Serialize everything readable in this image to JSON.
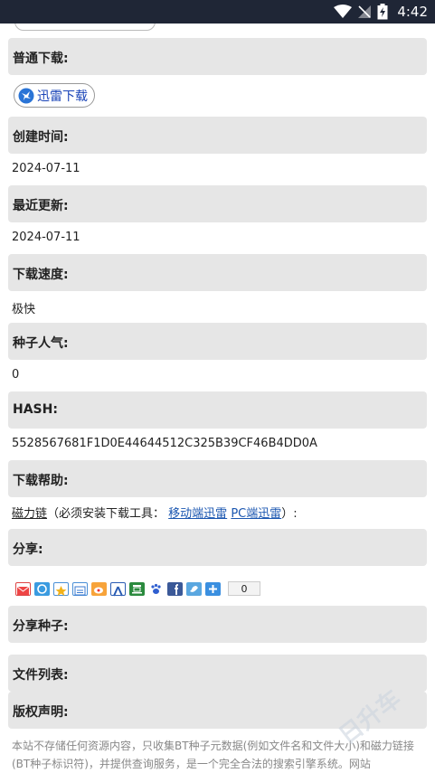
{
  "status": {
    "time": "4:42"
  },
  "sections": {
    "normal_download": "普通下载:",
    "created": "创建时间:",
    "updated": "最近更新:",
    "speed": "下载速度:",
    "popularity": "种子人气:",
    "hash": "HASH:",
    "help": "下载帮助:",
    "share": "分享:",
    "share_torrent": "分享种子:",
    "file_list": "文件列表:",
    "copyright": "版权声明:"
  },
  "values": {
    "created": "2024-07-11",
    "updated": "2024-07-11",
    "speed": "极快",
    "popularity": "0",
    "hash": "5528567681F1D0E44644512C325B39CF46B4DD0A"
  },
  "thunder_button": {
    "label": "迅雷下载"
  },
  "help_line": {
    "magnet": "磁力链",
    "text": "（必须安装下载工具：",
    "mobile_link": "移动端迅雷",
    "pc_link": "PC端迅雷",
    "tail": "）:"
  },
  "share": {
    "icons": [
      "email-icon",
      "qzone-icon",
      "star-icon",
      "douban-icon",
      "weibo-icon",
      "renren-icon",
      "douban-box-icon",
      "baidu-icon",
      "facebook-icon",
      "twitter-icon",
      "more-icon"
    ],
    "count": "0"
  },
  "disclaimer": "本站不存储任何资源内容，只收集BT种子元数据(例如文件名和文件大小)和磁力链接(BT种子标识符)，并提供查询服务，是一个完全合法的搜索引擎系统。网站",
  "watermark": "日升车"
}
